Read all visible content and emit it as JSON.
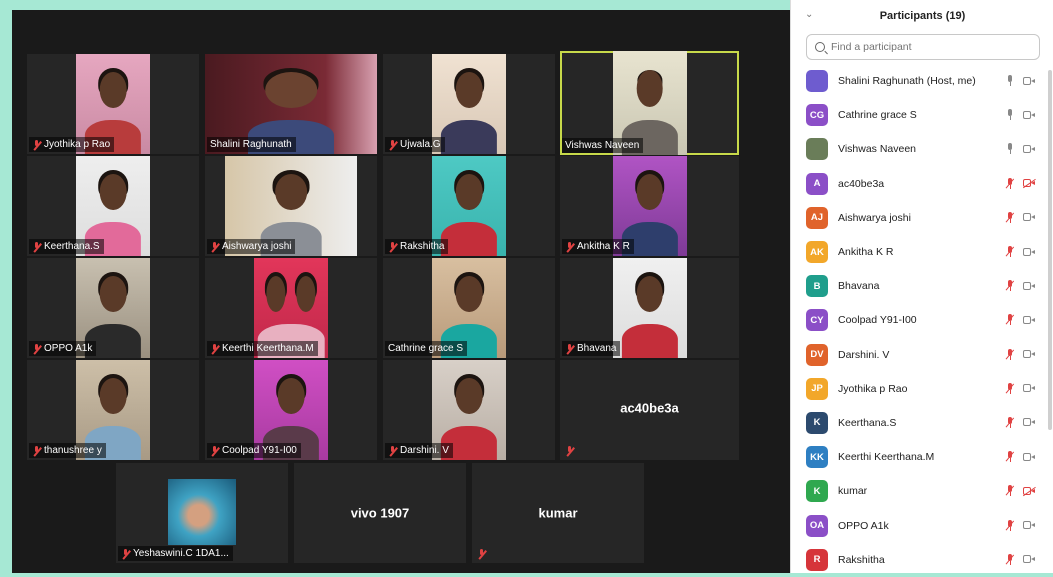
{
  "gallery": {
    "tiles": [
      {
        "name": "Jyothika p Rao",
        "muted": true
      },
      {
        "name": "Shalini Raghunath",
        "muted": false
      },
      {
        "name": "Ujwala.G",
        "muted": true
      },
      {
        "name": "Vishwas Naveen",
        "muted": false,
        "active": true
      },
      {
        "name": "Keerthana.S",
        "muted": true
      },
      {
        "name": "Aishwarya joshi",
        "muted": true
      },
      {
        "name": "Rakshitha",
        "muted": true
      },
      {
        "name": "Ankitha K R",
        "muted": true
      },
      {
        "name": "OPPO A1k",
        "muted": true
      },
      {
        "name": "Keerthi Keerthana.M",
        "muted": true
      },
      {
        "name": "Cathrine grace S",
        "muted": false
      },
      {
        "name": "Bhavana",
        "muted": true
      },
      {
        "name": "thanushree y",
        "muted": true
      },
      {
        "name": "Coolpad Y91-I00",
        "muted": true
      },
      {
        "name": "Darshini. V",
        "muted": true
      },
      {
        "name": "ac40be3a",
        "muted": true,
        "video_off": true
      },
      {
        "name": "Yeshaswini.C 1DA1...",
        "muted": true
      },
      {
        "name": "vivo 1907",
        "muted": false,
        "video_off": true
      },
      {
        "name": "kumar",
        "muted": true,
        "video_off": true
      }
    ]
  },
  "panel": {
    "title": "Participants (19)",
    "search_placeholder": "Find a participant",
    "participants": [
      {
        "initials": "",
        "name": "Shalini Raghunath (Host, me)",
        "color": "#6e5ccf",
        "mic_muted": false,
        "cam_off": false
      },
      {
        "initials": "CG",
        "name": "Cathrine grace S",
        "color": "#8b4fc7",
        "mic_muted": false,
        "cam_off": false
      },
      {
        "initials": "",
        "name": "Vishwas Naveen",
        "color": "#6a7d59",
        "mic_muted": false,
        "cam_off": false
      },
      {
        "initials": "A",
        "name": "ac40be3a",
        "color": "#8b4fc7",
        "mic_muted": true,
        "cam_off": true
      },
      {
        "initials": "AJ",
        "name": "Aishwarya joshi",
        "color": "#e0632b",
        "mic_muted": true,
        "cam_off": false
      },
      {
        "initials": "AK",
        "name": "Ankitha K R",
        "color": "#f2a72a",
        "mic_muted": true,
        "cam_off": false
      },
      {
        "initials": "B",
        "name": "Bhavana",
        "color": "#1f9e8c",
        "mic_muted": true,
        "cam_off": false
      },
      {
        "initials": "CY",
        "name": "Coolpad Y91-I00",
        "color": "#8b4fc7",
        "mic_muted": true,
        "cam_off": false
      },
      {
        "initials": "DV",
        "name": "Darshini. V",
        "color": "#e0632b",
        "mic_muted": true,
        "cam_off": false
      },
      {
        "initials": "JP",
        "name": "Jyothika p Rao",
        "color": "#f2a72a",
        "mic_muted": true,
        "cam_off": false
      },
      {
        "initials": "K",
        "name": "Keerthana.S",
        "color": "#2c4a6e",
        "mic_muted": true,
        "cam_off": false
      },
      {
        "initials": "KK",
        "name": "Keerthi Keerthana.M",
        "color": "#2e7fc2",
        "mic_muted": true,
        "cam_off": false
      },
      {
        "initials": "K",
        "name": "kumar",
        "color": "#2fa84f",
        "mic_muted": true,
        "cam_off": true
      },
      {
        "initials": "OA",
        "name": "OPPO A1k",
        "color": "#8b4fc7",
        "mic_muted": true,
        "cam_off": false
      },
      {
        "initials": "R",
        "name": "Rakshitha",
        "color": "#d6353a",
        "mic_muted": true,
        "cam_off": false
      }
    ]
  }
}
